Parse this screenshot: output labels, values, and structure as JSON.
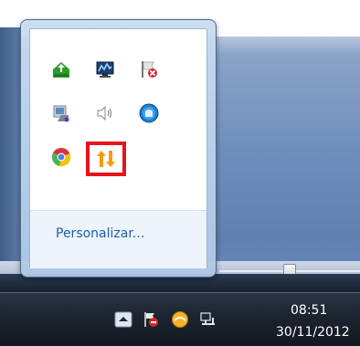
{
  "tray_overflow": {
    "customize_label": "Personalizar...",
    "icons": [
      {
        "name": "green-sync-icon"
      },
      {
        "name": "network-monitor-icon"
      },
      {
        "name": "action-center-flag-icon"
      },
      {
        "name": "device-computer-icon"
      },
      {
        "name": "volume-speaker-icon"
      },
      {
        "name": "blue-circle-app-icon"
      },
      {
        "name": "chrome-icon"
      },
      {
        "name": "upload-download-arrows-icon"
      }
    ],
    "highlight_color": "#e8141c"
  },
  "taskbar": {
    "time": "08:51",
    "date": "30/11/2012"
  },
  "colors": {
    "link": "#1e5ea8",
    "taskbar": "#1d2531"
  }
}
